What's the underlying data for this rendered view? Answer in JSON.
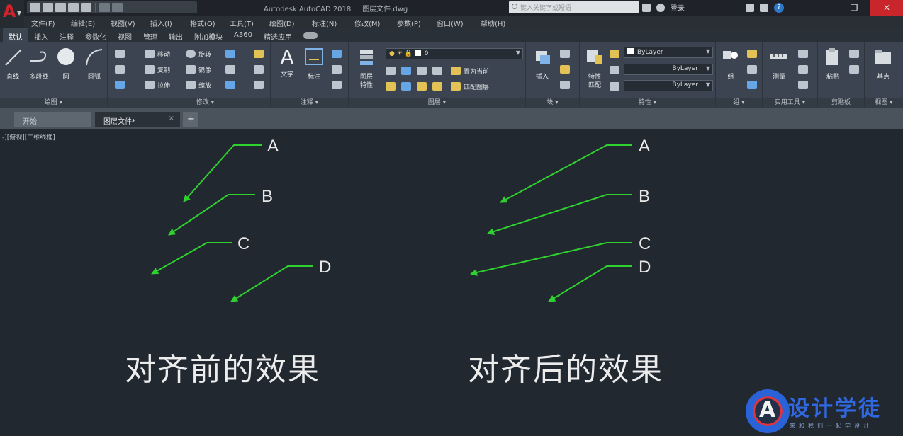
{
  "title_bar": {
    "app_title": "Autodesk AutoCAD 2018",
    "document": "图层文件.dwg",
    "search_placeholder": "键入关键字或短语",
    "signin": "登录",
    "help": "?"
  },
  "menu": [
    "文件(F)",
    "编辑(E)",
    "视图(V)",
    "插入(I)",
    "格式(O)",
    "工具(T)",
    "绘图(D)",
    "标注(N)",
    "修改(M)",
    "参数(P)",
    "窗口(W)",
    "帮助(H)"
  ],
  "ribbon_tabs": [
    "默认",
    "插入",
    "注释",
    "参数化",
    "视图",
    "管理",
    "输出",
    "附加模块",
    "A360",
    "精选应用"
  ],
  "ribbon": {
    "draw": {
      "title": "绘图 ▾",
      "line": "直线",
      "polyline": "多段线",
      "circle": "圆",
      "arc": "圆弧"
    },
    "modify": {
      "title": "修改 ▾",
      "move": "移动",
      "rotate": "旋转",
      "copy": "复制",
      "mirror": "镜像",
      "stretch": "拉伸",
      "scale": "缩放"
    },
    "annotation": {
      "title": "注释 ▾",
      "text": "文字",
      "dimension": "标注"
    },
    "layers": {
      "title": "图层 ▾",
      "properties": "图层",
      "properties2": "特性",
      "layer_value": "0",
      "make_current": "置为当前",
      "match_layer": "匹配图层"
    },
    "block": {
      "title": "块 ▾",
      "insert": "插入"
    },
    "properties": {
      "title": "特性 ▾",
      "match": "特性",
      "match2": "匹配",
      "color": "ByLayer",
      "linetype": "ByLayer",
      "lineweight": "ByLayer"
    },
    "groups": {
      "title": "组 ▾",
      "group": "组"
    },
    "utilities": {
      "title": "实用工具 ▾",
      "measure": "测量"
    },
    "clipboard": {
      "title": "剪贴板",
      "paste": "粘贴"
    },
    "view": {
      "title": "视图 ▾",
      "base": "基点"
    }
  },
  "doc_tabs": {
    "start": "开始",
    "current": "图层文件*",
    "close": "×",
    "add": "+"
  },
  "viewport_label": "-][俯视][二维线框]",
  "leaders_before": [
    "A",
    "B",
    "C",
    "D"
  ],
  "leaders_after": [
    "A",
    "B",
    "C",
    "D"
  ],
  "captions": {
    "before": "对齐前的效果",
    "after": "对齐后的效果"
  },
  "watermark": {
    "title": "设计学徒",
    "subtitle": "来和我们一起学设计",
    "letter": "A"
  },
  "colors": {
    "leader": "#2fd12f",
    "background": "#212830",
    "accent": "#2f68e0"
  }
}
